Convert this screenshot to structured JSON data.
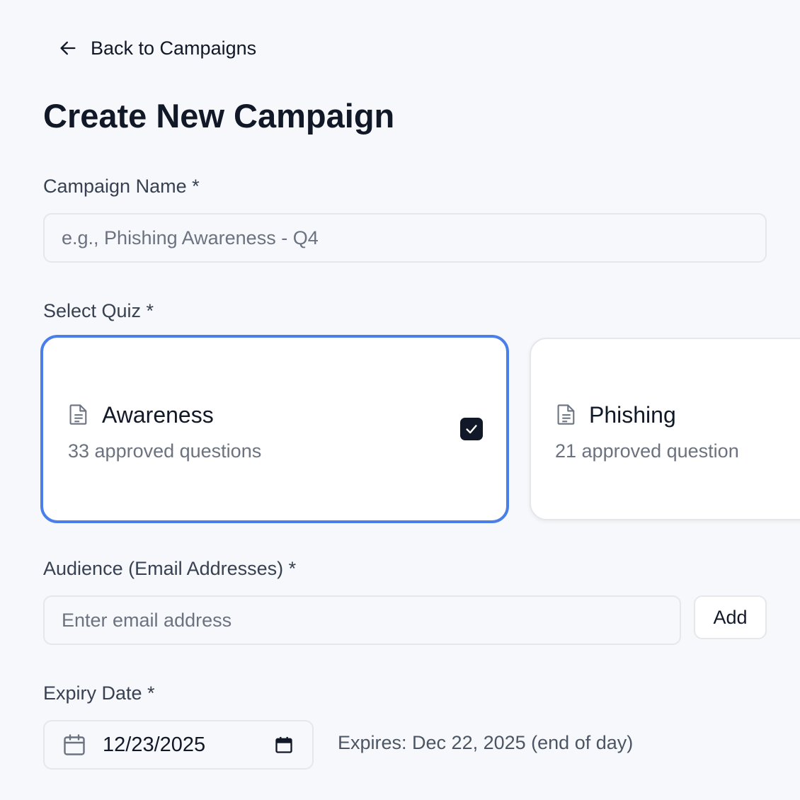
{
  "back_link": {
    "label": "Back to Campaigns",
    "icon": "arrow-left-icon"
  },
  "page_title": "Create New Campaign",
  "campaign_name": {
    "label": "Campaign Name *",
    "value": "",
    "placeholder": "e.g., Phishing Awareness - Q4"
  },
  "quiz": {
    "label": "Select Quiz *",
    "options": [
      {
        "name": "Awareness",
        "count": "33 approved questions",
        "selected": true,
        "icon": "document-icon"
      },
      {
        "name": "Phishing",
        "count": "21 approved question",
        "selected": false,
        "icon": "document-icon"
      }
    ]
  },
  "audience": {
    "label": "Audience (Email Addresses) *",
    "value": "",
    "placeholder": "Enter email address",
    "add_label": "Add"
  },
  "expiry": {
    "label": "Expiry Date *",
    "value": "12/23/2025",
    "note": "Expires: Dec 22, 2025 (end of day)"
  },
  "colors": {
    "selected_border": "#4a7ee8",
    "text_primary": "#111827",
    "text_muted": "#6b7280",
    "background": "#f7f8fb"
  }
}
